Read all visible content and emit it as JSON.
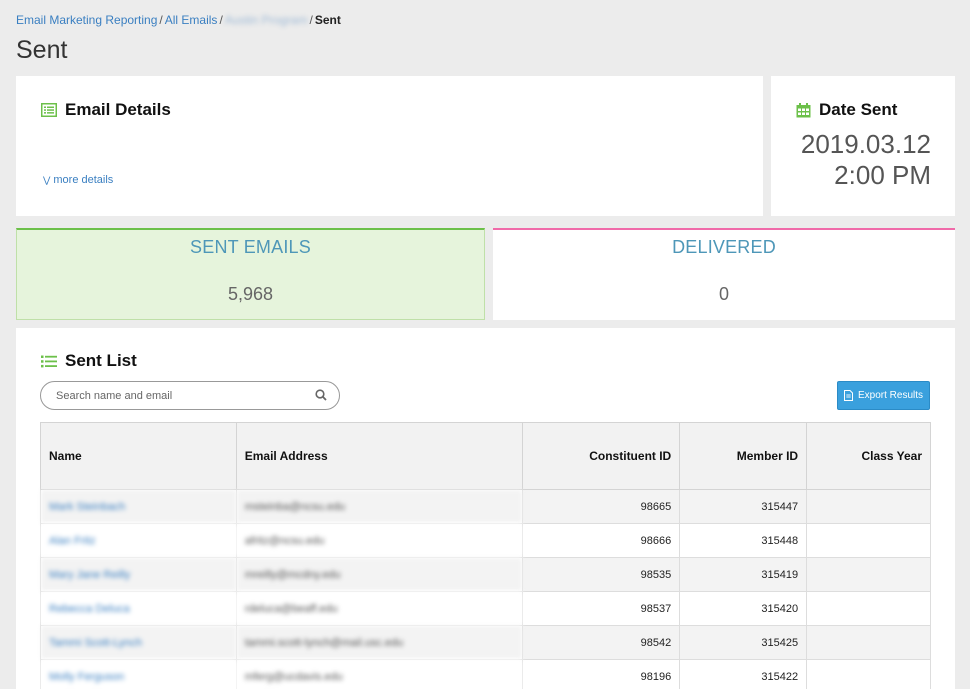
{
  "breadcrumb": {
    "items": [
      "Email Marketing Reporting",
      "All Emails",
      "Austin Program"
    ],
    "current": "Sent",
    "separator": "/"
  },
  "page": {
    "title": "Sent"
  },
  "email_details": {
    "title": "Email Details",
    "more_link": "more details"
  },
  "date_sent": {
    "title": "Date Sent",
    "date": "2019.03.12",
    "time": "2:00 PM"
  },
  "stats": {
    "sent": {
      "label": "SENT EMAILS",
      "value": "5,968",
      "accent": "#6cc04a"
    },
    "delivered": {
      "label": "DELIVERED",
      "value": "0",
      "accent": "#f06aa9"
    }
  },
  "sent_list": {
    "title": "Sent List",
    "search_placeholder": "Search name and email",
    "export_label": "Export Results",
    "columns": [
      "Name",
      "Email Address",
      "Constituent ID",
      "Member ID",
      "Class Year"
    ],
    "rows": [
      {
        "name": "Mark Steinbach",
        "email": "msteinba@ncsu.edu",
        "constituent_id": "98665",
        "member_id": "315447",
        "class_year": ""
      },
      {
        "name": "Alan Fritz",
        "email": "afritz@ncsu.edu",
        "constituent_id": "98666",
        "member_id": "315448",
        "class_year": ""
      },
      {
        "name": "Mary Jane Reilly",
        "email": "mreilly@mcdny.edu",
        "constituent_id": "98535",
        "member_id": "315419",
        "class_year": ""
      },
      {
        "name": "Rebecca Deluca",
        "email": "rdeluca@beaff.edu",
        "constituent_id": "98537",
        "member_id": "315420",
        "class_year": ""
      },
      {
        "name": "Tammi Scott-Lynch",
        "email": "tammi.scott-lynch@mail.usc.edu",
        "constituent_id": "98542",
        "member_id": "315425",
        "class_year": ""
      },
      {
        "name": "Molly Ferguson",
        "email": "mferg@ucdavis.edu",
        "constituent_id": "98196",
        "member_id": "315422",
        "class_year": ""
      }
    ]
  }
}
